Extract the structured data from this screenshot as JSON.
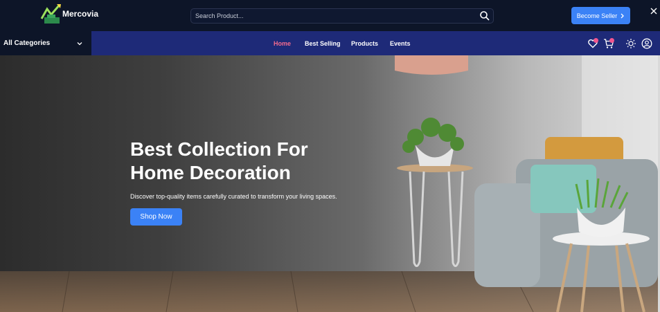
{
  "header": {
    "brand": "Mercovia",
    "search_placeholder": "Search Product...",
    "become_seller_label": "Become Seller"
  },
  "nav": {
    "categories_label": "All Categories",
    "links": [
      "Home",
      "Best Selling",
      "Products",
      "Events"
    ],
    "active": "Home",
    "wishlist_count": "0",
    "cart_count": "0"
  },
  "hero": {
    "title_line1": "Best Collection For",
    "title_line2": "Home Decoration",
    "description": "Discover top-quality items carefully curated to transform your living spaces.",
    "cta_label": "Shop Now"
  },
  "colors": {
    "header_bg": "#0d1528",
    "nav_bg": "#1e2a78",
    "accent": "#3b82f6",
    "active_link": "#f36b8e"
  }
}
